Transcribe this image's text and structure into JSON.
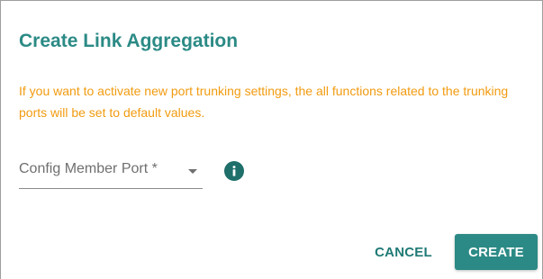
{
  "dialog": {
    "title": "Create Link Aggregation",
    "warning": "If you want to activate new port trunking settings, the all functions related to the trunking ports will be set to default values.",
    "member_port": {
      "label": "Config Member Port *",
      "value": ""
    },
    "info_icon": "info-icon",
    "actions": {
      "cancel_label": "CANCEL",
      "create_label": "CREATE"
    }
  },
  "colors": {
    "title": "#2b8a85",
    "warning": "#f29b10",
    "primary_button": "#2b8a85",
    "info_icon": "#1f6f6b"
  }
}
